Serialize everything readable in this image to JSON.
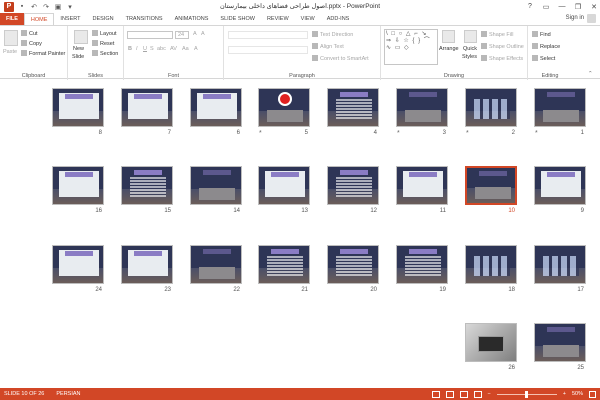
{
  "window": {
    "title": "اصول طراحی فضاهای داخلی بیمارستان.pptx - PowerPoint",
    "app_icon": "P",
    "qat": [
      "save-icon",
      "undo-icon",
      "redo-icon",
      "start-slideshow-icon",
      "customize-qat-icon"
    ],
    "controls": [
      "?",
      "▭",
      "—",
      "❐",
      "✕"
    ]
  },
  "tabs": {
    "file": "FILE",
    "items": [
      "HOME",
      "INSERT",
      "DESIGN",
      "TRANSITIONS",
      "ANIMATIONS",
      "SLIDE SHOW",
      "REVIEW",
      "VIEW",
      "ADD-INS"
    ],
    "active": "HOME",
    "signin": "Sign in"
  },
  "ribbon": {
    "clipboard": {
      "label": "Clipboard",
      "paste": "Paste",
      "cut": "Cut",
      "copy": "Copy",
      "format_painter": "Format Painter"
    },
    "slides": {
      "label": "Slides",
      "new_slide_1": "New",
      "new_slide_2": "Slide",
      "layout": "Layout",
      "reset": "Reset",
      "section": "Section"
    },
    "font": {
      "label": "Font",
      "size": "24",
      "grow": "A",
      "shrink": "A",
      "bold": "B",
      "italic": "I",
      "underline": "U",
      "strike": "S",
      "shadow": "abc",
      "spacing": "AV",
      "case": "Aa",
      "color": "A"
    },
    "paragraph": {
      "label": "Paragraph",
      "text_direction": "Text Direction",
      "align_text": "Align Text",
      "smartart": "Convert to SmartArt"
    },
    "drawing": {
      "label": "Drawing",
      "arrange": "Arrange",
      "quick_styles_1": "Quick",
      "quick_styles_2": "Styles",
      "shape_fill": "Shape Fill",
      "shape_outline": "Shape Outline",
      "shape_effects": "Shape Effects",
      "shapes_glyphs": "\\ □ ○ △ ⌐ ↘ ⇒ ⇩ ☆ { } ⌒ ∿ ▭ ◇"
    },
    "editing": {
      "label": "Editing",
      "find": "Find",
      "replace": "Replace",
      "select": "Select"
    }
  },
  "slides": [
    {
      "num": "1",
      "star": true,
      "style": "title"
    },
    {
      "num": "2",
      "star": true,
      "style": "diagram"
    },
    {
      "num": "3",
      "star": true,
      "style": "bldg"
    },
    {
      "num": "4",
      "star": false,
      "style": "text"
    },
    {
      "num": "5",
      "star": true,
      "style": "circle"
    },
    {
      "num": "6",
      "star": false,
      "style": "panel"
    },
    {
      "num": "7",
      "star": false,
      "style": "panel"
    },
    {
      "num": "8",
      "star": false,
      "style": "panel"
    },
    {
      "num": "9",
      "star": false,
      "style": "panel"
    },
    {
      "num": "10",
      "star": false,
      "style": "bldg",
      "selected": true
    },
    {
      "num": "11",
      "star": false,
      "style": "panel"
    },
    {
      "num": "12",
      "star": false,
      "style": "text"
    },
    {
      "num": "13",
      "star": false,
      "style": "panel"
    },
    {
      "num": "14",
      "star": false,
      "style": "bldg"
    },
    {
      "num": "15",
      "star": false,
      "style": "text"
    },
    {
      "num": "16",
      "star": false,
      "style": "panel"
    },
    {
      "num": "17",
      "star": false,
      "style": "diagram"
    },
    {
      "num": "18",
      "star": false,
      "style": "diagram"
    },
    {
      "num": "19",
      "star": false,
      "style": "text"
    },
    {
      "num": "20",
      "star": false,
      "style": "text"
    },
    {
      "num": "21",
      "star": false,
      "style": "text"
    },
    {
      "num": "22",
      "star": false,
      "style": "bldg"
    },
    {
      "num": "23",
      "star": false,
      "style": "panel"
    },
    {
      "num": "24",
      "star": false,
      "style": "panel"
    },
    {
      "num": "25",
      "star": false,
      "style": "bldg"
    },
    {
      "num": "26",
      "star": false,
      "style": "photo"
    }
  ],
  "status": {
    "slide_info": "SLIDE 10 OF 26",
    "language": "PERSIAN",
    "zoom": "50%"
  },
  "colors": {
    "accent": "#d24726",
    "slide_bg": "#2e3556"
  }
}
